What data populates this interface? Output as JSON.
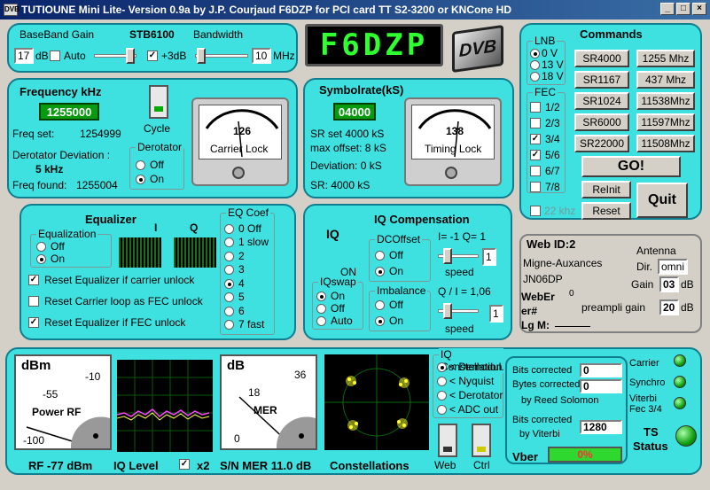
{
  "window": {
    "title": "TUTIOUNE Mini Lite- Version 0.9a by J.P. Courjaud F6DZP  for PCI card TT S2-3200 or KNCone HD",
    "icon": "app-icon",
    "min": "_",
    "max": "□",
    "close": "×"
  },
  "baseband": {
    "gain_label": "BaseBand Gain",
    "gain_value": "17",
    "gain_unit": "dB",
    "auto_label": "Auto",
    "chip": "STB6100",
    "plus3db_label": "+3dB",
    "bandwidth_label": "Bandwidth",
    "bandwidth_value": "10",
    "bandwidth_unit": "MHz"
  },
  "callsign_display": "F6DZP",
  "dvb_logo": "DVB",
  "frequency": {
    "title": "Frequency kHz",
    "value": "1255000",
    "cycle_label": "Cycle",
    "freq_set_label": "Freq set:",
    "freq_set_value": "1254999",
    "derot_dev_label": "Derotator Deviation :",
    "derot_dev_value": "5 kHz",
    "freq_found_label": "Freq found:",
    "freq_found_value": "1255004",
    "derotator_label": "Derotator",
    "off_label": "Off",
    "on_label": "On",
    "meter_value": "126",
    "meter_caption": "Carrier Lock"
  },
  "symbolrate": {
    "title": "Symbolrate(kS)",
    "value": "04000",
    "sr_set": "SR set   4000 kS",
    "max_offset": "max offset:  8 kS",
    "deviation": "Deviation: 0 kS",
    "sr": "SR:   4000 kS",
    "meter_value": "138",
    "meter_caption": "Timing Lock"
  },
  "commands": {
    "title": "Commands",
    "lnb_label": "LNB",
    "lnb_options": [
      "0 V",
      "13 V",
      "18 V"
    ],
    "fec_label": "FEC",
    "fec_options": [
      "1/2",
      "2/3",
      "3/4",
      "5/6",
      "6/7",
      "7/8"
    ],
    "sr_buttons": [
      "SR4000",
      "SR1167",
      "SR1024",
      "SR6000",
      "SR22000"
    ],
    "freq_buttons": [
      "1255 Mhz",
      "437 Mhz",
      "11538Mhz",
      "11597Mhz",
      "11508Mhz"
    ],
    "go_label": "GO!",
    "reinit_label": "ReInit",
    "reset_label": "Reset",
    "quit_label": "Quit",
    "khz22_label": "22 khz"
  },
  "equalizer": {
    "title": "Equalizer",
    "i_label": "I",
    "q_label": "Q",
    "equalization_label": "Equalization",
    "off_label": "Off",
    "on_label": "On",
    "eq_coef_label": "EQ Coef",
    "coef_options": [
      "0 Off",
      "1 slow",
      "2",
      "3",
      "4",
      "5",
      "6",
      "7 fast"
    ],
    "reset_eq_carrier": "Reset Equalizer if carrier unlock",
    "reset_carrier_fec": "Reset Carrier loop as FEC unlock",
    "reset_eq_fec": "Reset Equalizer if FEC unlock"
  },
  "iq": {
    "title": "IQ Compensation",
    "iq_label": "IQ",
    "on_state": "ON",
    "iqswap_label": "IQswap",
    "iqswap_options": [
      "On",
      "Off",
      "Auto"
    ],
    "dcoffset_label": "DCOffset",
    "imbalance_label": "Imbalance",
    "off_label": "Off",
    "on_label": "On",
    "iq_values": "I= -1   Q= 1",
    "speed_label": "speed",
    "speed1_value": "1",
    "qi_ratio": "Q / I =  1,06",
    "speed2_value": "1"
  },
  "web": {
    "title": "Web ID:2",
    "location": "Migne-Auxances",
    "locator": "JN06DP",
    "weber_label": "WebEr",
    "weber_value": "0",
    "err_label": "er#",
    "lgm_label": "Lg M:",
    "antenna_label": "Antenna",
    "dir_label": "Dir.",
    "dir_value": "omni",
    "gain_label": "Gain",
    "gain_value": "03",
    "gain_unit": "dB",
    "preampli_label": "preampli gain",
    "preampli_value": "20",
    "preampli_unit": "dB"
  },
  "bottom": {
    "dbm_label": "dBm",
    "power_ticks": [
      "-10",
      "-55",
      "-100"
    ],
    "power_caption": "Power RF",
    "rf_label": "RF -77 dBm",
    "iq_level_label": "IQ Level",
    "x2_label": "x2",
    "db_label": "dB",
    "mer_ticks": [
      "36",
      "18",
      "0"
    ],
    "mer_caption": "MER",
    "sn_mer_label": "S/N MER 11.0 dB",
    "constellation_label": "Constellations",
    "iq_const_label": "IQ Constellation",
    "iq_const_options": [
      "< Demodul.",
      "< Nyquist",
      "< Derotator",
      "< ADC out"
    ],
    "web_label": "Web",
    "ctrl_label": "Ctrl",
    "bits_corrected_label": "Bits corrected",
    "bits_corrected_value": "0",
    "bytes_corrected_label": "Bytes corrected",
    "bytes_corrected_value": "0",
    "reed_solomon_label": "by Reed Solomon",
    "bits_viterbi_label": "Bits corrected",
    "by_viterbi_label": "by Viterbi",
    "bits_viterbi_value": "1280",
    "vber_label": "Vber",
    "vber_value": "0%",
    "carrier_label": "Carrier",
    "synchro_label": "Synchro",
    "viterbi_label": "Viterbi",
    "fec_label": "Fec  3/4",
    "ts_label": "TS",
    "status_label": "Status"
  }
}
